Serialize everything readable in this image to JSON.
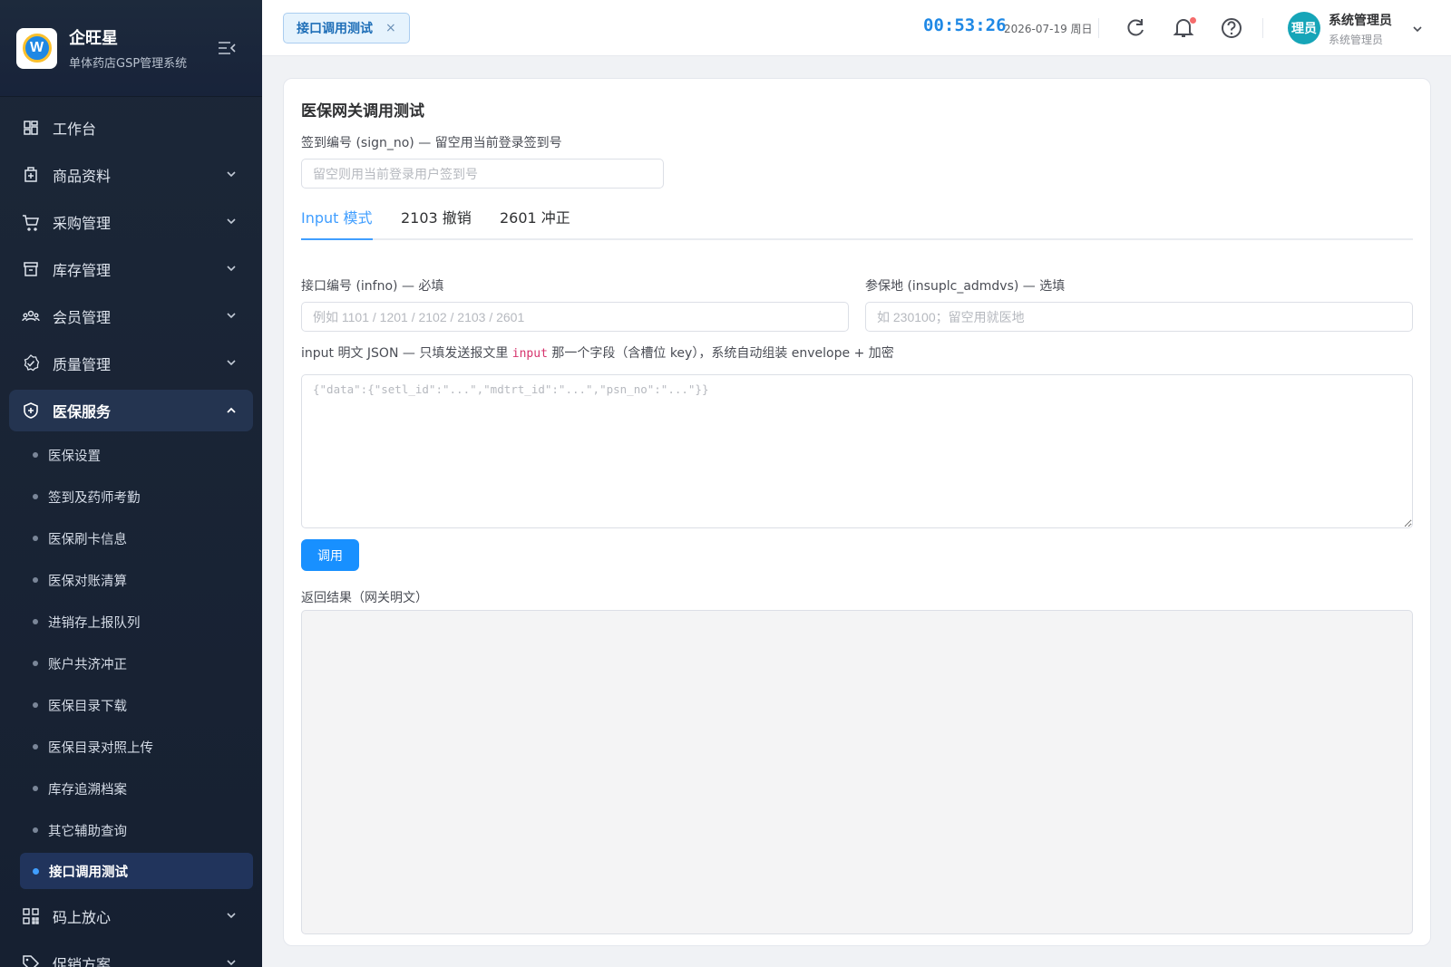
{
  "app": {
    "name": "企旺星",
    "subtitle": "单体药店GSP管理系统",
    "logo_letter": "W"
  },
  "sidebar": {
    "items": [
      {
        "label": "工作台",
        "icon": "dashboard-icon",
        "expandable": false
      },
      {
        "label": "商品资料",
        "icon": "medicine-box-icon",
        "expandable": true
      },
      {
        "label": "采购管理",
        "icon": "cart-icon",
        "expandable": true
      },
      {
        "label": "库存管理",
        "icon": "warehouse-icon",
        "expandable": true
      },
      {
        "label": "会员管理",
        "icon": "users-icon",
        "expandable": true
      },
      {
        "label": "质量管理",
        "icon": "quality-badge-icon",
        "expandable": true
      },
      {
        "label": "医保服务",
        "icon": "shield-icon",
        "expandable": true,
        "expanded": true
      }
    ],
    "subitems": [
      "医保设置",
      "签到及药师考勤",
      "医保刷卡信息",
      "医保对账清算",
      "进销存上报队列",
      "账户共济冲正",
      "医保目录下载",
      "医保目录对照上传",
      "库存追溯档案",
      "其它辅助查询",
      "接口调用测试"
    ],
    "current_subitem": "接口调用测试",
    "items_after": [
      {
        "label": "码上放心",
        "icon": "qrcode-icon",
        "expandable": true
      },
      {
        "label": "促销方案",
        "icon": "tag-icon",
        "expandable": true
      }
    ]
  },
  "header": {
    "open_tab": "接口调用测试",
    "close_glyph": "×",
    "time": "00:53:26",
    "date": "2026-07-19 周日",
    "user": {
      "avatar_text": "理员",
      "name": "系统管理员",
      "role": "系统管理员"
    }
  },
  "page": {
    "title": "医保网关调用测试",
    "sign_no": {
      "label": "签到编号 (sign_no) — 留空用当前登录签到号",
      "value": "",
      "placeholder": "留空则用当前登录用户签到号"
    },
    "tabs": [
      "Input 模式",
      "2103 撤销",
      "2601 冲正"
    ],
    "active_tab": "Input 模式",
    "infno": {
      "label": "接口编号 (infno) — 必填",
      "value": "",
      "placeholder": "例如 1101 / 1201 / 2102 / 2103 / 2601"
    },
    "insuplc": {
      "label": "参保地 (insuplc_admdvs) — 选填",
      "value": "",
      "placeholder": "如 230100；留空用就医地"
    },
    "json_input": {
      "label_before": "input 明文 JSON — 只填发送报文里 ",
      "label_code": "input",
      "label_after": " 那一个字段（含槽位 key），系统自动组装 envelope + 加密",
      "value": "",
      "placeholder": "{\"data\":{\"setl_id\":\"...\",\"mdtrt_id\":\"...\",\"psn_no\":\"...\"}}"
    },
    "call_button": "调用",
    "result": {
      "label": "返回结果（网关明文）",
      "value": ""
    }
  },
  "colors": {
    "sidebar_bg": "#1c2738",
    "accent": "#409eff",
    "button": "#1890ff",
    "clock": "#1e88e5",
    "avatar": "#16a5b8"
  }
}
